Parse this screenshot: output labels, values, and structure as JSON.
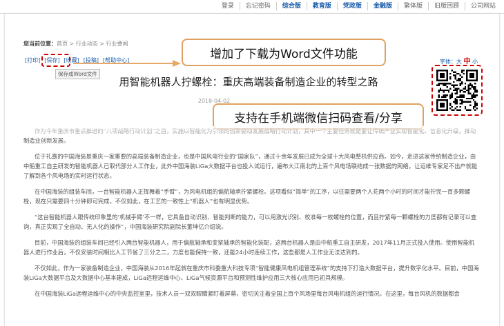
{
  "topnav": {
    "items": [
      "登录",
      "忘记密码",
      "综合版",
      "教育版",
      "党政版",
      "金融版",
      "繁体版",
      "旧版回顾",
      "公司网站"
    ]
  },
  "breadcrumb": {
    "label": "您当前位置：",
    "path": "首页 > 行业动态 > 行业要闻"
  },
  "toolbar": {
    "print": "[打印]",
    "save": "[保存]",
    "favorite": "[收藏]",
    "submit": "[投稿]",
    "help": "[帮助中心]",
    "save_tooltip": "保存成Word文件"
  },
  "callouts": {
    "word_feature": "增加了下载为Word文件功能",
    "wechat_feature": "支持在手机端微信扫码查看/分享"
  },
  "fontsize": {
    "label": "字体：",
    "large": "大",
    "medium": "中",
    "small": "小"
  },
  "article": {
    "title": "用智能机器人拧螺栓：重庆高端装备制造企业的转型之路",
    "date": "2018-04-02",
    "paragraphs": [
      "作为今年重庆市重点推进的“八项战略行动计划”之首，实施以智能化为引领的创新驱动发展战略行动计划，其中一个主要任务就是要让传统产业实现智能化、信息化升级，推动制造业创新发展。",
      "位于礼嘉的中国海装是重庆一家重要的高端装备制造企业，也是中国风电行业的“国家队”，通过十余年发展已成为全球十大风电整机供应商。如今，走进这家传统制造企业，由中船重工自主研发的智能机器人已取代部分人工作业，此外中国海装LiGa大数据平台也投入试运行，遍布大江南北的上百个风电场联结成一张数据的网络，让运维专家足不出户就能了解到各个风电场的实时运行状态。",
      "在中国海装的组装车间，一台智能机器人正挥舞着“手臂”，为风电机组的偏航轴承拧紧螺栓。这项看似“简单”的工序，以往需要两个人花两个小时的时间才能拧完一百多颗螺栓，现在只需要四十分钟即可完成。不仅如此，在工艺的一致性上“机器人”也有明显优势。",
      "“这台智能机器人跟传统印象里的‘机械手臂’不一样，它具备自动识别、智能判断的能力，可以用激光识别、校准每一枚螺栓的位置，而且拧紧每一颗螺栓的力度都有记录可以查询，真正实现了全自动、无人化的操作”，中国海装研究院副院长董坤亿介绍说。",
      "目前，中国海装的组装车间已经引入两台智能机器人，用于偏航轴承和变桨轴承的智能化装配，这两台机器人是由中船重工自主研发，2017年11月正式投入使用。使用智能机器人进行作业后，不仅安装时间相比人工节省了三分之二，力度也能保持一致，还能24小时连续工作，这些都是人工作业无法达到的。",
      "不仅如此，作为一家装备制造企业，中国海装从2016年起就在重庆市科委重大科技专项“智能健康风电机组管理系统”的支持下打造大数据平台，提升数字化水平。目前，中国海装LiGa大数据平台及大数据中心基本建成，LiGa远程运维中心、LiGa气候资源平台和预测性维护应用三大核心应用已初具规模。",
      "在中国海装LiGa远程运维中心的中央监控室里，技术人员一双双眼睛紧盯着屏幕，密切关注着全国上百个风场里每台风电机组的运行情况。在这里，每台风机的数据都会"
    ]
  },
  "colors": {
    "callout_border": "#e0a060",
    "dashed_highlight": "#cc0000",
    "arrow": "#e8a868",
    "link": "#1a5dab"
  }
}
